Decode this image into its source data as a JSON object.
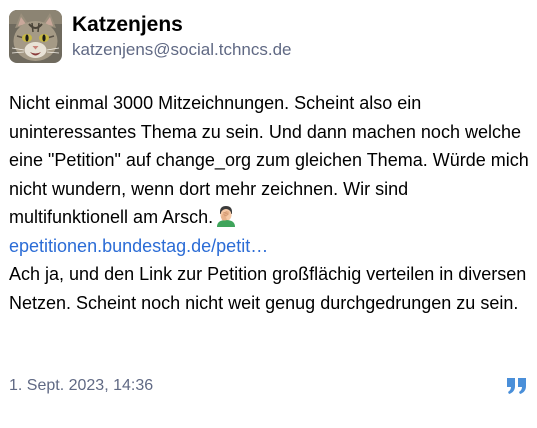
{
  "account": {
    "display_name": "Katzenjens",
    "handle": "katzenjens@social.tchncs.de",
    "avatar_icon": "cat-avatar-icon"
  },
  "post": {
    "paragraph1_text": "Nicht einmal 3000 Mitzeichnungen. Scheint also ein uninteressantes Thema zu sein. Und dann machen noch welche eine \"Petition\" auf change_org zum gleichen Thema. Würde mich nicht wundern, wenn dort mehr zeichnen. Wir sind multifunktionell am Arsch.",
    "emoji_icon": "facepalm-emoji-icon",
    "link_text": "epetitionen.bundestag.de/petit…",
    "paragraph2_text": "Ach ja, und den Link zur Petition großflächig verteilen in diversen Netzen. Scheint noch nicht weit genug durchgedrungen zu sein."
  },
  "footer": {
    "timestamp": "1. Sept. 2023, 14:36",
    "quote_icon": "quote-icon"
  },
  "colors": {
    "text": "#000000",
    "muted": "#606984",
    "link": "#2b6cd6",
    "quote_icon": "#4a8fd9"
  }
}
